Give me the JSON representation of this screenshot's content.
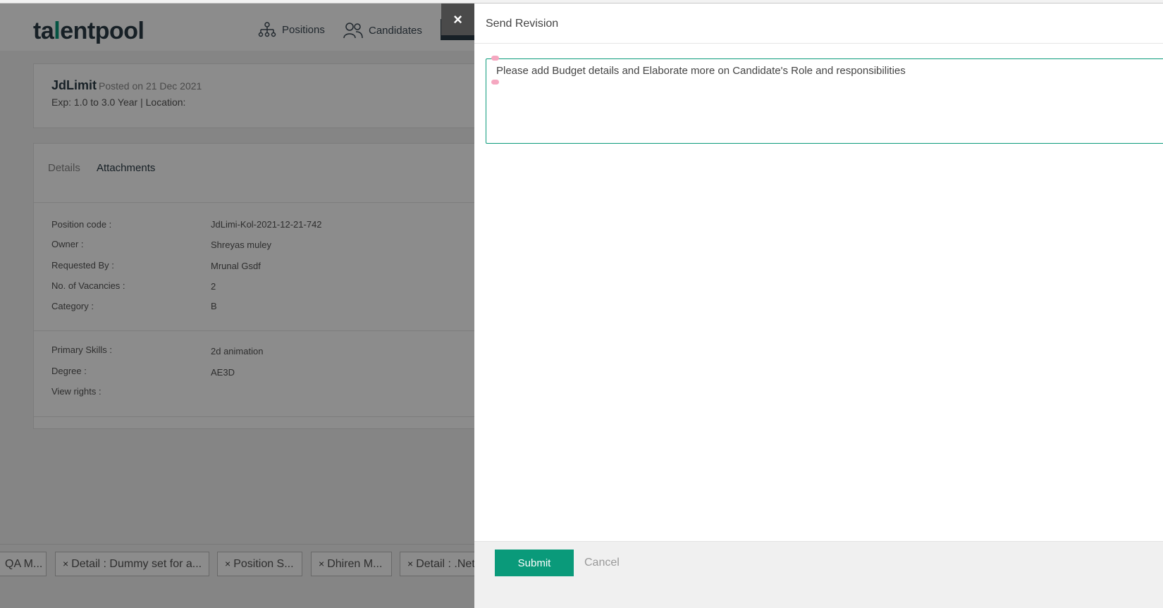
{
  "app": {
    "logo": {
      "part1": "ta",
      "accent": "l",
      "part2": "entpool"
    },
    "nav": {
      "positions": "Positions",
      "candidates": "Candidates"
    }
  },
  "job": {
    "title": "JdLimit",
    "posted": "Posted on 21 Dec 2021",
    "meta": "Exp: 1.0 to 3.0 Year | Location:"
  },
  "tabs": {
    "details": "Details",
    "attachments": "Attachments"
  },
  "fields": [
    {
      "label": "Position code :",
      "value": "JdLimi-Kol-2021-12-21-742"
    },
    {
      "label": "Owner :",
      "value": "Shreyas muley"
    },
    {
      "label": "Requested By :",
      "value": "Mrunal Gsdf"
    },
    {
      "label": "No. of Vacancies :",
      "value": "2"
    },
    {
      "label": "Category :",
      "value": "B"
    },
    {
      "label": "Primary Skills :",
      "value": "2d animation"
    },
    {
      "label": "Degree :",
      "value": "AE3D"
    },
    {
      "label": "View rights :",
      "value": ""
    }
  ],
  "bottom_tabs": [
    {
      "close": "",
      "label": "QA M..."
    },
    {
      "close": "×",
      "label": "Detail : Dummy set for a..."
    },
    {
      "close": "×",
      "label": "Position S..."
    },
    {
      "close": "×",
      "label": "Dhiren M..."
    },
    {
      "close": "×",
      "label": "Detail : .Net"
    }
  ],
  "close_button": "×",
  "panel": {
    "title": "Send Revision",
    "revision_text": "Please add Budget details and Elaborate more on Candidate's Role and responsibilities",
    "submit_label": "Submit",
    "cancel_label": "Cancel"
  },
  "colors": {
    "accent": "#0a9a7a",
    "overlay": "rgba(0,0,0,0.45)",
    "close_bg": "#4a4a4a"
  },
  "icons": {
    "positions": "org-chart-icon",
    "candidates": "people-icon",
    "close": "close-icon"
  }
}
